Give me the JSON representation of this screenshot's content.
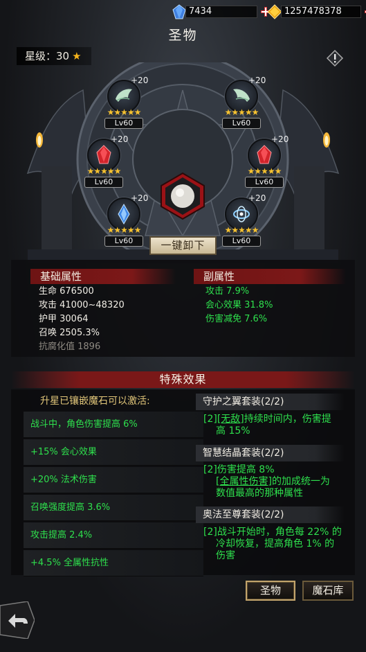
{
  "resources": {
    "crystal": {
      "value": "7434",
      "icon": "blue-crystal-icon"
    },
    "gold": {
      "value": "1257478378",
      "icon": "gold-gem-icon"
    }
  },
  "header": {
    "title": "圣物"
  },
  "star_level": {
    "label": "星级：30",
    "star": "★"
  },
  "slots": [
    {
      "name": "wing-left",
      "bonus": "+20",
      "stars": "★★★★★",
      "level": "Lv60"
    },
    {
      "name": "wing-right",
      "bonus": "+20",
      "stars": "★★★★★",
      "level": "Lv60"
    },
    {
      "name": "crystal-red-left",
      "bonus": "+20",
      "stars": "★★★★★",
      "level": "Lv60"
    },
    {
      "name": "crystal-red-right",
      "bonus": "+20",
      "stars": "★★★★★",
      "level": "Lv60"
    },
    {
      "name": "crystal-blue-left",
      "bonus": "+20",
      "stars": "★★★★★",
      "level": "Lv60"
    },
    {
      "name": "ring-blue-right",
      "bonus": "+20",
      "stars": "★★★★★",
      "level": "Lv60"
    }
  ],
  "unequip_all": "一键卸下",
  "base_attributes": {
    "title": "基础属性",
    "lines": [
      "生命 676500",
      "攻击 41000~48320",
      "护甲 30064",
      "召唤 2505.3%",
      "抗腐化值 1896"
    ]
  },
  "sub_attributes": {
    "title": "副属性",
    "lines": [
      "攻击 7.9%",
      "会心效果 31.8%",
      "伤害减免 7.6%"
    ]
  },
  "special": {
    "title": "特殊效果",
    "activate_label": "升星已镶嵌魔石可以激活:",
    "effects": [
      "战斗中，角色伤害提高 6%",
      "+15% 会心效果",
      "+20% 法术伤害",
      "召唤强度提高 3.6%",
      "攻击提高 2.4%",
      "+4.5% 全属性抗性"
    ],
    "sets": [
      {
        "title": "守护之翼套装(2/2)",
        "desc_a": "[2]",
        "kw": "[无敌]",
        "desc_b": "持续时间内，伤害提",
        "desc_c": "高 15%"
      },
      {
        "title": "智慧结晶套装(2/2)",
        "desc_a": "[2]伤害提高 8%",
        "kw": "[全属性伤害]",
        "desc_b": "的加成统一为",
        "desc_c": "数值最高的那种属性"
      },
      {
        "title": "奥法至尊套装(2/2)",
        "desc_a": "[2]战斗开始时，角色每 22% 的",
        "desc_b": "冷却恢复，提高角色 1% 的",
        "desc_c": "伤害"
      }
    ]
  },
  "tabs": {
    "relic": "圣物",
    "magic_stone": "魔石库"
  }
}
